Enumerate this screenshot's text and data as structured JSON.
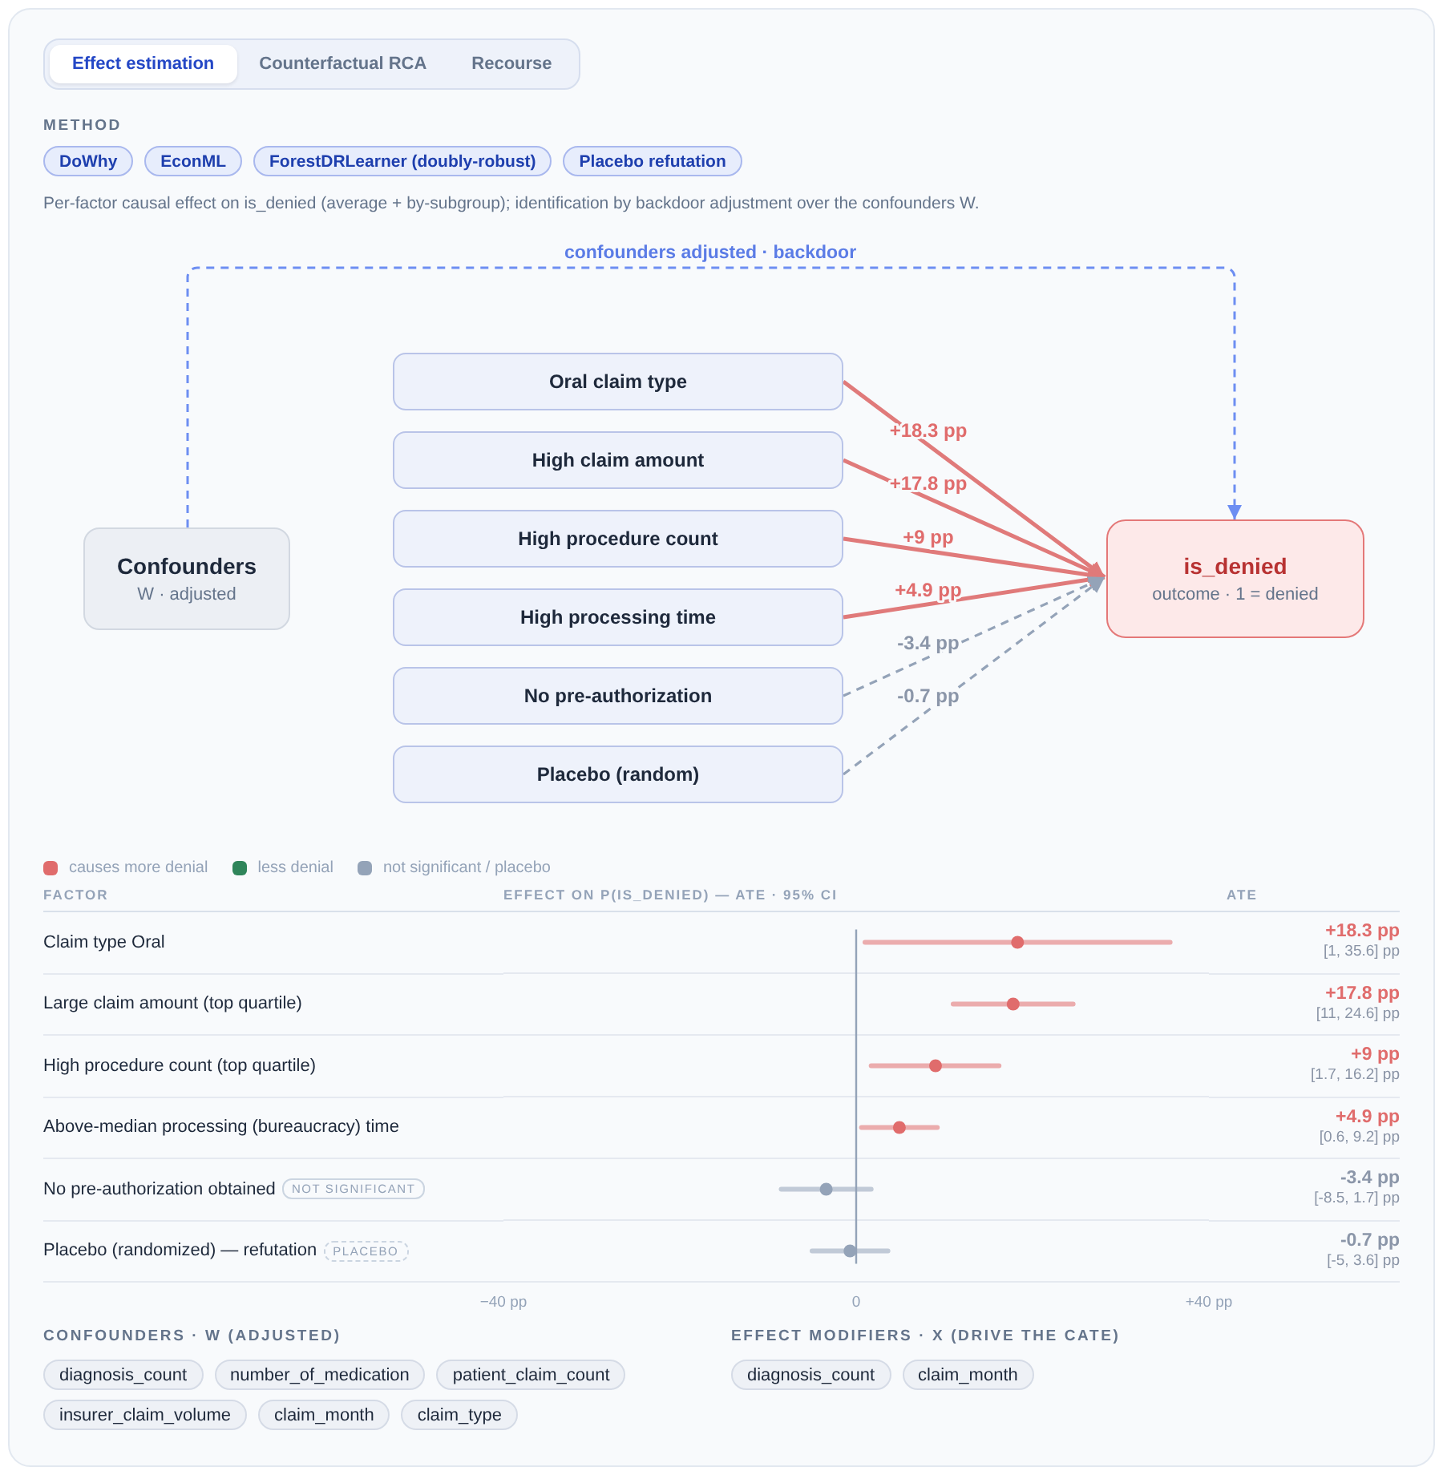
{
  "tabs": [
    {
      "label": "Effect estimation",
      "selected": true
    },
    {
      "label": "Counterfactual RCA",
      "selected": false
    },
    {
      "label": "Recourse",
      "selected": false
    }
  ],
  "method": {
    "label": "METHOD",
    "chips": [
      "DoWhy",
      "EconML",
      "ForestDRLearner (doubly-robust)",
      "Placebo refutation"
    ],
    "description": "Per-factor causal effect on is_denied (average + by-subgroup); identification by backdoor adjustment over the confounders W."
  },
  "diagram": {
    "backdoor_label": "confounders adjusted · backdoor",
    "confounders": {
      "title": "Confounders",
      "subtitle": "W · adjusted"
    },
    "factors": [
      {
        "name": "Oral claim type",
        "effect": "+18.3 pp",
        "significant": true
      },
      {
        "name": "High claim amount",
        "effect": "+17.8 pp",
        "significant": true
      },
      {
        "name": "High procedure count",
        "effect": "+9 pp",
        "significant": true
      },
      {
        "name": "High processing time",
        "effect": "+4.9 pp",
        "significant": true
      },
      {
        "name": "No pre-authorization",
        "effect": "-3.4 pp",
        "significant": false
      },
      {
        "name": "Placebo (random)",
        "effect": "-0.7 pp",
        "significant": false
      }
    ],
    "outcome": {
      "title": "is_denied",
      "subtitle": "outcome · 1 = denied"
    }
  },
  "effects": {
    "legend": [
      {
        "label": "causes more denial",
        "color": "#e06c6c"
      },
      {
        "label": "less denial",
        "color": "#2f855a"
      },
      {
        "label": "not significant / placebo",
        "color": "#94a3b8"
      }
    ],
    "columns": [
      "FACTOR",
      "EFFECT ON P(IS_DENIED) — ATE · 95% CI",
      "ATE"
    ],
    "rows": [
      {
        "kind": "effect",
        "color": "#e06c6c",
        "ate": "+18.3 pp",
        "ci": "[1, 35.6] pp"
      },
      {
        "kind": "effect",
        "color": "#e06c6c",
        "ate": "+17.8 pp",
        "ci": "[11, 24.6] pp"
      },
      {
        "kind": "effect",
        "color": "#e06c6c",
        "ate": "+9 pp",
        "ci": "[1.7, 16.2] pp"
      },
      {
        "kind": "effect",
        "color": "#e06c6c",
        "ate": "+4.9 pp",
        "ci": "[0.6, 9.2] pp"
      },
      {
        "kind": "not_significant",
        "badge": "NOT SIGNIFICANT",
        "color": "#94a3b8",
        "ate": "-3.4 pp",
        "ci": "[-8.5, 1.7] pp"
      },
      {
        "kind": "placebo",
        "badge": "PLACEBO",
        "color": "#94a3b8",
        "ate": "-0.7 pp",
        "ci": "[-5, 3.6] pp"
      }
    ],
    "chart_data": {
      "type": "scatter",
      "orientation": "horizontal",
      "categories": [
        "Claim type Oral",
        "Large claim amount (top quartile)",
        "High procedure count (top quartile)",
        "Above-median processing (bureaucracy) time",
        "No pre-authorization obtained",
        "Placebo (randomized) — refutation"
      ],
      "values": [
        18.3,
        17.8,
        9,
        4.9,
        -3.4,
        -0.7
      ],
      "errors": [
        [
          1,
          35.6
        ],
        [
          11,
          24.6
        ],
        [
          1.7,
          16.2
        ],
        [
          0.6,
          9.2
        ],
        [
          -8.5,
          1.7
        ],
        [
          -5,
          3.6
        ]
      ],
      "ref_lines": [
        {
          "axis": "x",
          "value": 0
        }
      ],
      "grid": true,
      "xlim": [
        -40,
        40
      ],
      "xticks": [
        {
          "value": -40,
          "label": "−40 pp"
        },
        {
          "value": 0,
          "label": "0"
        },
        {
          "value": 40,
          "label": "+40 pp"
        }
      ]
    }
  },
  "confounders": {
    "label": "CONFOUNDERS · W (ADJUSTED)",
    "chips": [
      "diagnosis_count",
      "number_of_medication",
      "patient_claim_count",
      "insurer_claim_volume",
      "claim_month",
      "claim_type"
    ]
  },
  "effect_modifiers": {
    "label": "EFFECT MODIFIERS · X (DRIVE THE CATE)",
    "chips": [
      "diagnosis_count",
      "claim_month"
    ]
  }
}
